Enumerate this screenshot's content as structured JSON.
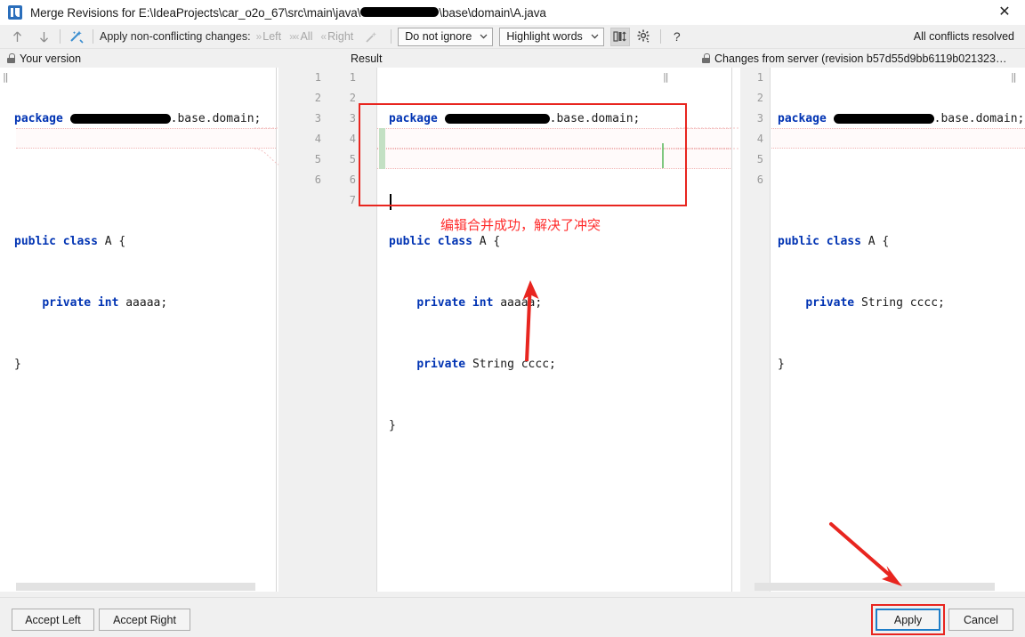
{
  "window": {
    "title_prefix": "Merge Revisions for E:\\IdeaProjects\\car_o2o_67\\src\\main\\java\\",
    "title_suffix": "\\base\\domain\\A.java",
    "app_icon": "intellij-idea-icon",
    "close_label": "✕"
  },
  "toolbar": {
    "prev_diff_icon": "arrow-up-icon",
    "next_diff_icon": "arrow-down-icon",
    "magic_resolve_icon": "magic-resolve-icon",
    "apply_label": "Apply non-conflicting changes:",
    "actions": [
      {
        "glyph": "»",
        "label": "Left"
      },
      {
        "glyph": "»«",
        "label": "All"
      },
      {
        "glyph": "«",
        "label": "Right"
      }
    ],
    "wand_icon": "magic-wand-icon",
    "ignore_select": {
      "value": "Do not ignore",
      "chevron": "⌄"
    },
    "highlight_select": {
      "value": "Highlight words",
      "chevron": "⌄"
    },
    "collapse_icon": "collapse-unchanged-icon",
    "settings_icon": "gear-icon",
    "help_icon": "help-icon",
    "help_label": "?",
    "status": "All conflicts resolved"
  },
  "panes": {
    "left": {
      "header": "Your version",
      "lock_icon": "lock-icon",
      "fold_marker": "‖",
      "lines": [
        [
          {
            "t": "package ",
            "k": true
          },
          {
            "redact": 108
          },
          {
            "t": ".base.domain;",
            "k": false
          }
        ],
        [],
        [
          {
            "t": "public class ",
            "k": true
          },
          {
            "t": "A {",
            "k": false
          }
        ],
        [
          {
            "t": "    private int ",
            "k": true,
            "indent": true
          },
          {
            "t": "aaaaa;",
            "k": false
          }
        ],
        [
          {
            "t": "}",
            "k": false
          }
        ]
      ]
    },
    "center": {
      "header": "Result",
      "gutter_left_numbers": [
        "1",
        "2",
        "3",
        "4",
        "5",
        "6"
      ],
      "gutter_right_numbers": [
        "1",
        "2",
        "3",
        "4",
        "5",
        "6",
        "7"
      ],
      "fold_marker": "‖",
      "lines": [
        [
          {
            "t": "package ",
            "k": true
          },
          {
            "redact": 112
          },
          {
            "t": ".base.domain;",
            "k": false
          }
        ],
        [],
        [
          {
            "t": "public class ",
            "k": true
          },
          {
            "t": "A {",
            "k": false
          }
        ],
        [
          {
            "t": "    private int ",
            "k": true,
            "indent": true
          },
          {
            "t": "aaaaa;",
            "k": false
          }
        ],
        [
          {
            "t": "    private ",
            "k": true,
            "indent": true
          },
          {
            "t": "String cccc;",
            "k": false
          }
        ],
        [
          {
            "t": "}",
            "k": false
          }
        ],
        []
      ]
    },
    "right": {
      "header": "Changes from server (revision b57d55d9bb6119b021323…",
      "lock_icon": "lock-icon",
      "fold_marker": "‖",
      "numbers": [
        "1",
        "2",
        "3",
        "4",
        "5",
        "6"
      ],
      "lines": [
        [
          {
            "t": "package ",
            "k": true
          },
          {
            "redact": 108
          },
          {
            "t": ".base.domain;",
            "k": false
          }
        ],
        [],
        [
          {
            "t": "public class ",
            "k": true
          },
          {
            "t": "A {",
            "k": false
          }
        ],
        [
          {
            "t": "    private ",
            "k": true,
            "indent": true
          },
          {
            "t": "String cccc;",
            "k": false
          }
        ],
        [
          {
            "t": "}",
            "k": false
          }
        ],
        []
      ]
    }
  },
  "annotations": {
    "note_text": "编辑合并成功，解决了冲突",
    "note_color": "#ff2b2b",
    "box_color": "#e8251f",
    "arrow_up_name": "red-arrow-up",
    "arrow_down_name": "red-arrow-to-apply"
  },
  "footer": {
    "accept_left": "Accept Left",
    "accept_right": "Accept Right",
    "apply": "Apply",
    "cancel": "Cancel"
  },
  "colors": {
    "accent": "#1f7ec8",
    "annotation_red": "#e8251f",
    "keyword_blue": "#0033b3",
    "added_green": "#c3e0c3",
    "conflict_pink": "#f0b4b4"
  }
}
